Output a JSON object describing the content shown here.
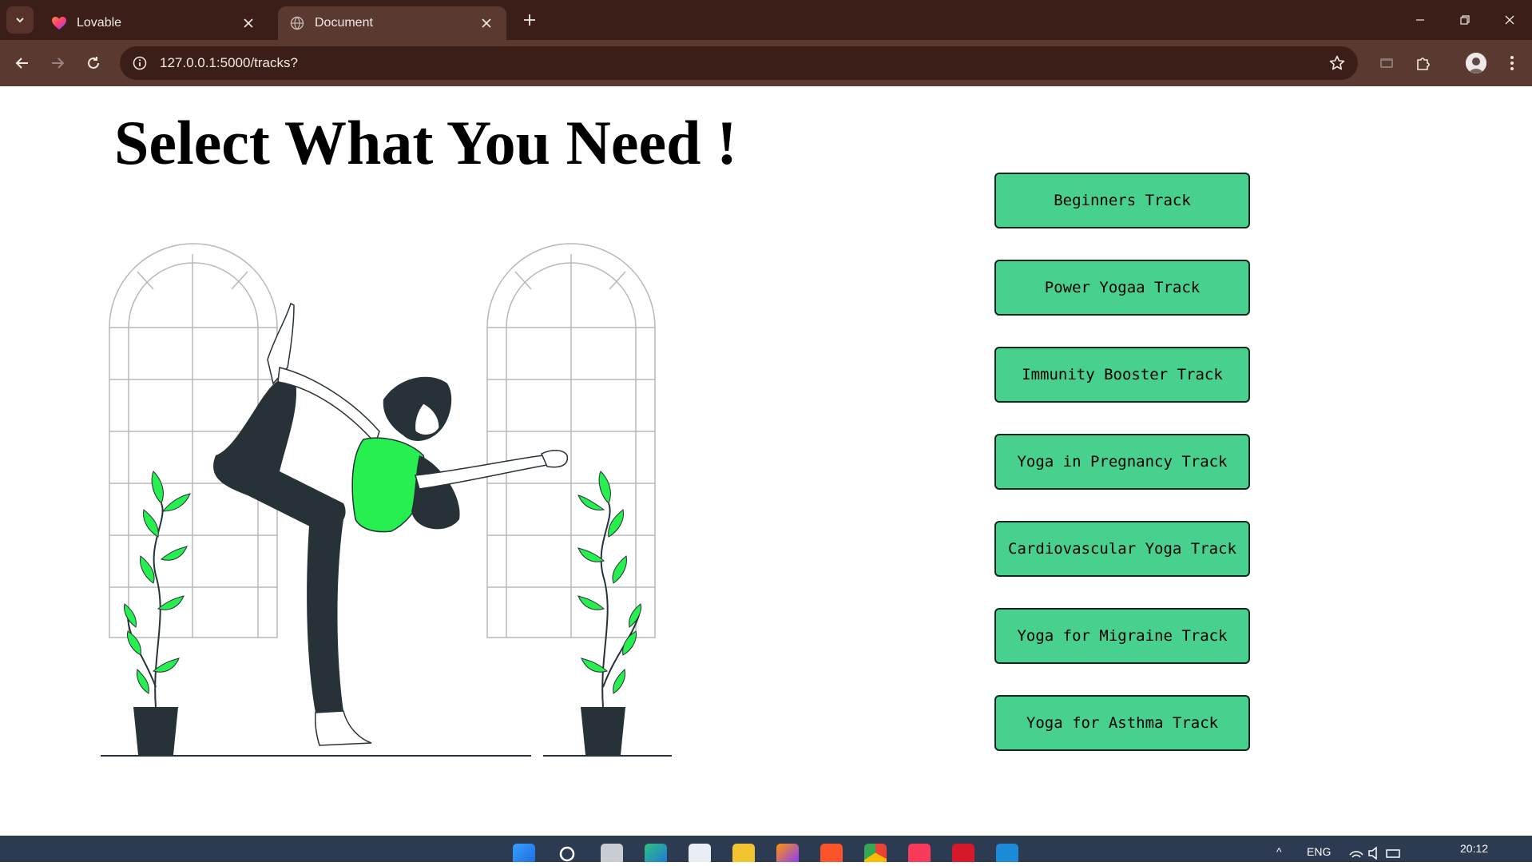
{
  "browser": {
    "tabs": [
      {
        "title": "Lovable",
        "active": false
      },
      {
        "title": "Document",
        "active": true
      }
    ],
    "url": "127.0.0.1:5000/tracks?"
  },
  "page": {
    "heading": "Select What You Need !",
    "tracks": [
      "Beginners Track",
      "Power Yogaa Track",
      "Immunity Booster Track",
      "Yoga in Pregnancy Track",
      "Cardiovascular Yoga Track",
      "Yoga for Migraine Track",
      "Yoga for Asthma Track"
    ]
  },
  "taskbar": {
    "language": "ENG",
    "time": "20:12"
  },
  "colors": {
    "tabstrip": "#3b1e17",
    "toolbar": "#5a3931",
    "track_button": "#48d08f",
    "accent_green": "#26ef4f",
    "figure_dark": "#263238"
  }
}
